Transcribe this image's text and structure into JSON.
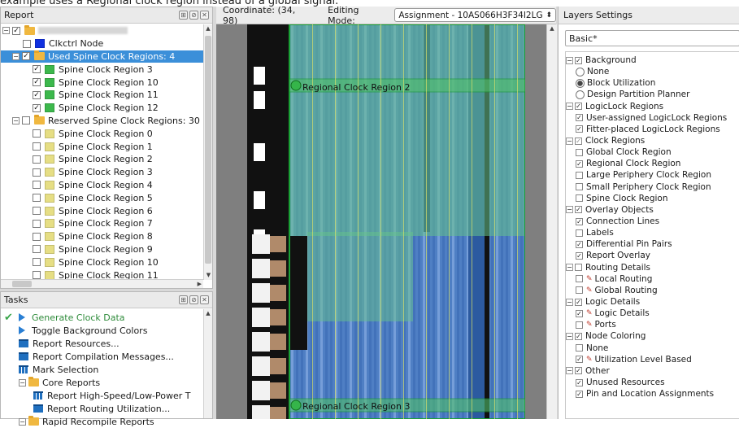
{
  "caption": "example uses a Regional clock region instead of a global signal.",
  "report": {
    "title": "Report",
    "rows": [
      {
        "type": "root",
        "label": "",
        "swatch": "",
        "checked": true,
        "folder": true
      },
      {
        "type": "item",
        "label": "Clkctrl Node",
        "swatch": "#1030e0",
        "checked": false,
        "indent": 1
      },
      {
        "type": "group",
        "label": "Used Spine Clock Regions: 4",
        "checked": true,
        "folder": true,
        "selected": true,
        "indent": 1
      },
      {
        "type": "item",
        "label": "Spine Clock Region 3",
        "swatch": "#3cb84c",
        "checked": true,
        "indent": 2
      },
      {
        "type": "item",
        "label": "Spine Clock Region 10",
        "swatch": "#3cb84c",
        "checked": true,
        "indent": 2
      },
      {
        "type": "item",
        "label": "Spine Clock Region 11",
        "swatch": "#3cb84c",
        "checked": true,
        "indent": 2
      },
      {
        "type": "item",
        "label": "Spine Clock Region 12",
        "swatch": "#3cb84c",
        "checked": true,
        "indent": 2
      },
      {
        "type": "group",
        "label": "Reserved Spine Clock Regions: 30",
        "checked": false,
        "folder": true,
        "indent": 1
      },
      {
        "type": "item",
        "label": "Spine Clock Region 0",
        "swatch": "#e6de84",
        "checked": false,
        "indent": 2
      },
      {
        "type": "item",
        "label": "Spine Clock Region 1",
        "swatch": "#e6de84",
        "checked": false,
        "indent": 2
      },
      {
        "type": "item",
        "label": "Spine Clock Region 2",
        "swatch": "#e6de84",
        "checked": false,
        "indent": 2
      },
      {
        "type": "item",
        "label": "Spine Clock Region 3",
        "swatch": "#e6de84",
        "checked": false,
        "indent": 2
      },
      {
        "type": "item",
        "label": "Spine Clock Region 4",
        "swatch": "#e6de84",
        "checked": false,
        "indent": 2
      },
      {
        "type": "item",
        "label": "Spine Clock Region 5",
        "swatch": "#e6de84",
        "checked": false,
        "indent": 2
      },
      {
        "type": "item",
        "label": "Spine Clock Region 6",
        "swatch": "#e6de84",
        "checked": false,
        "indent": 2
      },
      {
        "type": "item",
        "label": "Spine Clock Region 7",
        "swatch": "#e6de84",
        "checked": false,
        "indent": 2
      },
      {
        "type": "item",
        "label": "Spine Clock Region 8",
        "swatch": "#e6de84",
        "checked": false,
        "indent": 2
      },
      {
        "type": "item",
        "label": "Spine Clock Region 9",
        "swatch": "#e6de84",
        "checked": false,
        "indent": 2
      },
      {
        "type": "item",
        "label": "Spine Clock Region 10",
        "swatch": "#e6de84",
        "checked": false,
        "indent": 2
      },
      {
        "type": "item",
        "label": "Spine Clock Region 11",
        "swatch": "#e6de84",
        "checked": false,
        "indent": 2
      }
    ]
  },
  "tasks": {
    "title": "Tasks",
    "items": [
      {
        "label": "Generate Clock Data",
        "icon": "play",
        "done": true,
        "color": "#2e8b3a"
      },
      {
        "label": "Toggle Background Colors",
        "icon": "play"
      },
      {
        "label": "Report Resources...",
        "icon": "report"
      },
      {
        "label": "Report Compilation Messages...",
        "icon": "report"
      },
      {
        "label": "Mark Selection",
        "icon": "grid"
      },
      {
        "label": "Core Reports",
        "icon": "folder",
        "group": true
      },
      {
        "label": "Report High-Speed/Low-Power T",
        "icon": "grid",
        "indent": true
      },
      {
        "label": "Report Routing Utilization...",
        "icon": "report",
        "indent": true
      },
      {
        "label": "Rapid Recompile Reports",
        "icon": "folder",
        "group": true
      }
    ]
  },
  "toolbar": {
    "coordinate_label": "Coordinate: (34, 98)",
    "mode_label": "Editing Mode:",
    "mode_value": "Assignment - 10AS066H3F34I2LG"
  },
  "canvas": {
    "region_top_label": "Regional Clock Region 2",
    "region_bottom_label": "Regional Clock Region 3"
  },
  "layers": {
    "title": "Layers Settings",
    "preset": "Basic*",
    "items": [
      {
        "kind": "group",
        "label": "Background",
        "checked": true
      },
      {
        "kind": "radio",
        "label": "None",
        "on": false
      },
      {
        "kind": "radio",
        "label": "Block Utilization",
        "on": true
      },
      {
        "kind": "radio",
        "label": "Design Partition Planner",
        "on": false
      },
      {
        "kind": "group",
        "label": "LogicLock Regions",
        "checked": true
      },
      {
        "kind": "check",
        "label": "User-assigned LogicLock Regions",
        "checked": true
      },
      {
        "kind": "check",
        "label": "Fitter-placed LogicLock Regions",
        "checked": true
      },
      {
        "kind": "group",
        "label": "Clock Regions",
        "checked": true,
        "partial": true
      },
      {
        "kind": "check",
        "label": "Global Clock Region",
        "checked": false
      },
      {
        "kind": "check",
        "label": "Regional Clock Region",
        "checked": true
      },
      {
        "kind": "check",
        "label": "Large Periphery Clock Region",
        "checked": false
      },
      {
        "kind": "check",
        "label": "Small Periphery Clock Region",
        "checked": false
      },
      {
        "kind": "check",
        "label": "Spine Clock Region",
        "checked": false
      },
      {
        "kind": "group",
        "label": "Overlay Objects",
        "checked": true
      },
      {
        "kind": "check",
        "label": "Connection Lines",
        "checked": true
      },
      {
        "kind": "check",
        "label": "Labels",
        "checked": false
      },
      {
        "kind": "check",
        "label": "Differential Pin Pairs",
        "checked": true
      },
      {
        "kind": "check",
        "label": "Report Overlay",
        "checked": true
      },
      {
        "kind": "group",
        "label": "Routing Details",
        "checked": false
      },
      {
        "kind": "check",
        "label": "Local Routing",
        "checked": false,
        "pen": true
      },
      {
        "kind": "check",
        "label": "Global Routing",
        "checked": false,
        "pen": true
      },
      {
        "kind": "group",
        "label": "Logic Details",
        "checked": true
      },
      {
        "kind": "check",
        "label": "Logic Details",
        "checked": true,
        "pen": true
      },
      {
        "kind": "check",
        "label": "Ports",
        "checked": false,
        "pen": true
      },
      {
        "kind": "group",
        "label": "Node Coloring",
        "checked": true
      },
      {
        "kind": "check",
        "label": "None",
        "checked": false
      },
      {
        "kind": "check",
        "label": "Utilization Level Based",
        "checked": true,
        "pen": true
      },
      {
        "kind": "group",
        "label": "Other",
        "checked": true
      },
      {
        "kind": "check",
        "label": "Unused Resources",
        "checked": true
      },
      {
        "kind": "check",
        "label": "Pin and Location Assignments",
        "checked": true
      }
    ]
  }
}
